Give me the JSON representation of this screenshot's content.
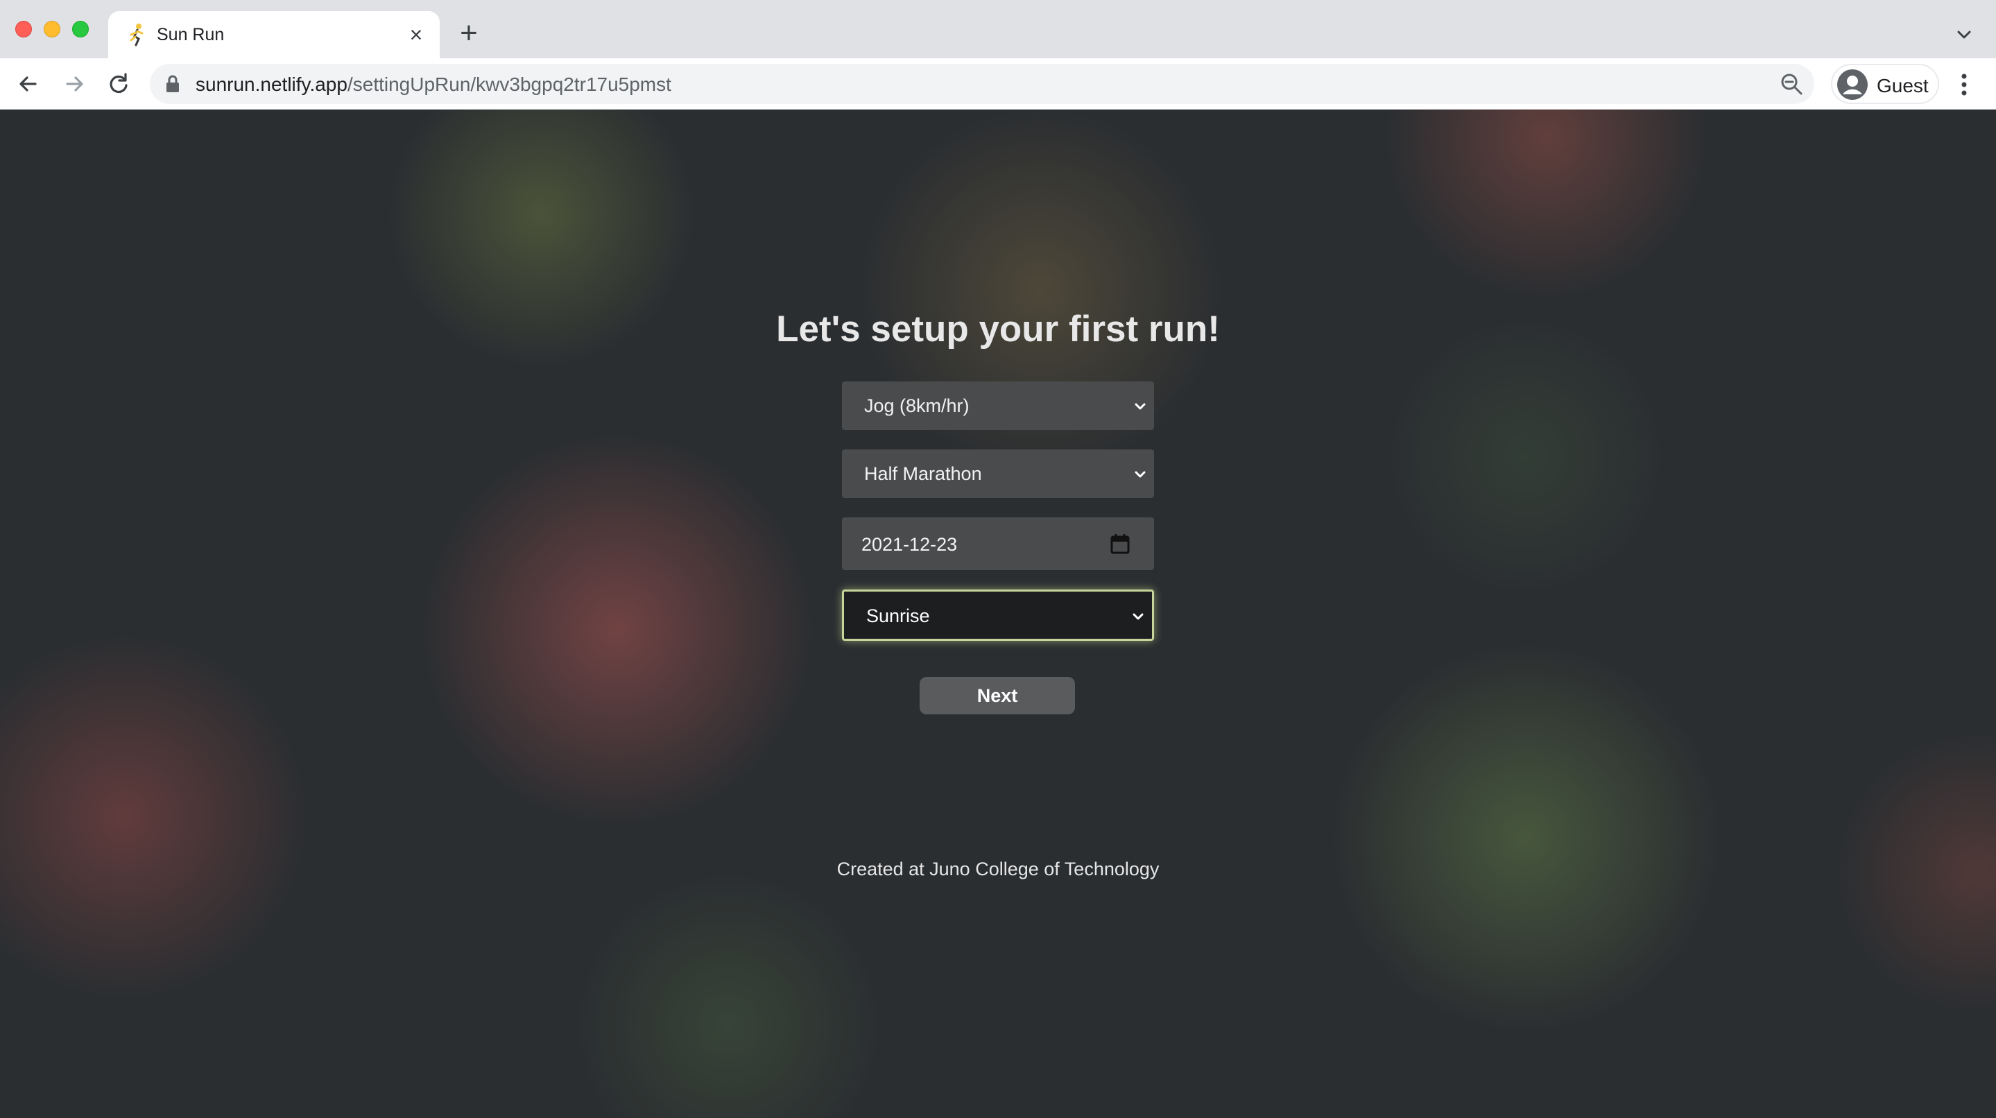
{
  "browser": {
    "tab": {
      "title": "Sun Run",
      "favicon": "runner-icon"
    },
    "new_tab_label": "+",
    "close_label": "×",
    "address": {
      "host": "sunrun.netlify.app",
      "path": "/settingUpRun/kwv3bgpq2tr17u5pmst"
    },
    "profile_label": "Guest"
  },
  "page": {
    "heading": "Let's setup your first run!",
    "form": {
      "pace": {
        "selected": "Jog (8km/hr)"
      },
      "distance": {
        "selected": "Half Marathon"
      },
      "date": {
        "value": "2021-12-23"
      },
      "time_of_day": {
        "selected": "Sunrise",
        "focused": true
      }
    },
    "next_label": "Next",
    "footer": "Created at Juno College of Technology"
  },
  "colors": {
    "background": "#2b2e31",
    "field": "#4a4b4d",
    "focused_field": "#1d1e20",
    "focus_ring": "#c7d59a",
    "button": "#5a5b5d"
  }
}
